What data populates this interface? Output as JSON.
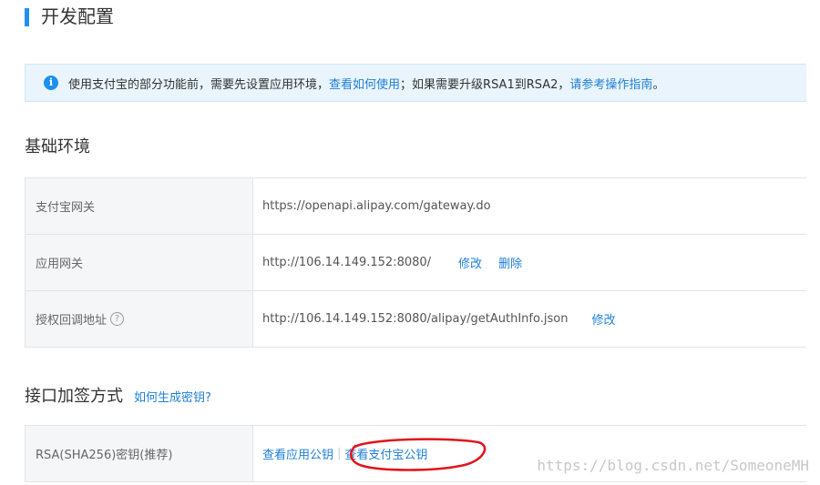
{
  "page": {
    "title": "开发配置"
  },
  "notice": {
    "text1": "使用支付宝的部分功能前，需要先设置应用环境，",
    "link1": "查看如何使用",
    "text2": "；如果需要升级RSA1到RSA2，",
    "link2": "请参考操作指南",
    "text3": "。"
  },
  "basic_env": {
    "title": "基础环境",
    "rows": [
      {
        "label": "支付宝网关",
        "value": "https://openapi.alipay.com/gateway.do"
      },
      {
        "label": "应用网关",
        "value": "http://106.14.149.152:8080/",
        "actions": [
          "修改",
          "删除"
        ]
      },
      {
        "label": "授权回调地址",
        "value": "http://106.14.149.152:8080/alipay/getAuthInfo.json",
        "actions": [
          "修改"
        ]
      }
    ],
    "help_icon": "?"
  },
  "signing": {
    "title": "接口加签方式",
    "help_link": "如何生成密钥?",
    "row": {
      "label": "RSA(SHA256)密钥(推荐)",
      "link1": "查看应用公钥",
      "divider": "|",
      "link2": "查看支付宝公钥"
    }
  },
  "watermark": "https://blog.csdn.net/SomeoneMH",
  "colors": {
    "accent": "#1e8ff0",
    "link": "#1e7fd6",
    "annotation": "#e0141c"
  },
  "icons": {
    "notice": "info-icon",
    "help": "question-circle-icon"
  }
}
